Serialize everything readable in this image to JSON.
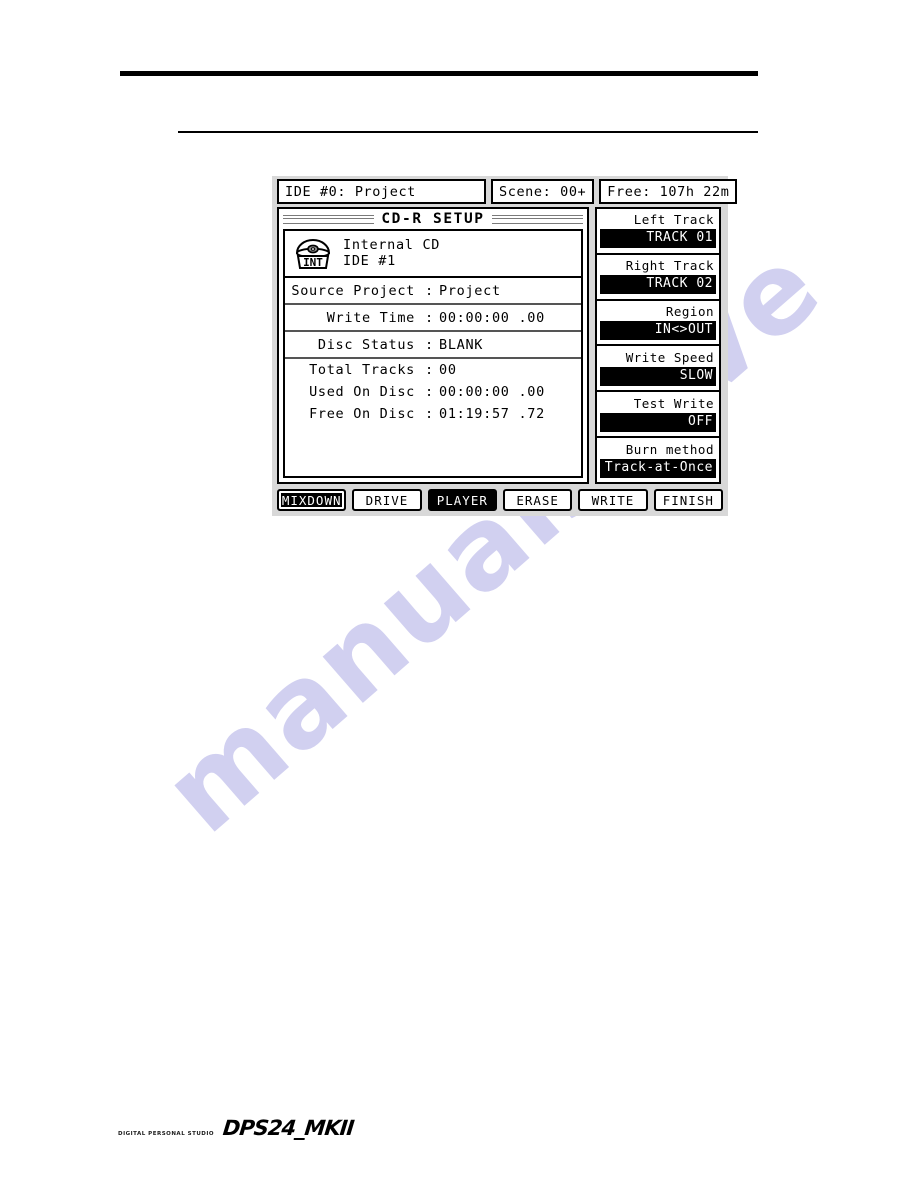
{
  "page": {
    "watermark": "manualshive",
    "footer": {
      "tagline": "DIGITAL PERSONAL STUDIO",
      "model": "DPS24_MKII"
    }
  },
  "device_screen": {
    "topbar": {
      "project": "IDE #0: Project",
      "scene": "Scene: 00+",
      "free_time": "Free: 107h 22m"
    },
    "screen_title": "CD-R SETUP",
    "device": {
      "icon": "cd-disc-icon",
      "icon_label": "INT",
      "name": "Internal CD",
      "bus": "IDE #1"
    },
    "info_rows": [
      {
        "label": "Source Project",
        "colon": ":",
        "value": "Project"
      },
      {
        "label": "Write Time",
        "colon": ":",
        "value": "00:00:00 .00"
      },
      {
        "label": "Disc Status",
        "colon": ":",
        "value": "BLANK"
      },
      {
        "label": "Total Tracks",
        "colon": ":",
        "value": "00"
      },
      {
        "label": "Used On Disc",
        "colon": ":",
        "value": "00:00:00 .00"
      },
      {
        "label": "Free On Disc",
        "colon": ":",
        "value": "01:19:57 .72"
      }
    ],
    "params": [
      {
        "label": "Left Track",
        "value": "TRACK 01"
      },
      {
        "label": "Right Track",
        "value": "TRACK 02"
      },
      {
        "label": "Region",
        "value": "IN<>OUT"
      },
      {
        "label": "Write Speed",
        "value": "SLOW"
      },
      {
        "label": "Test Write",
        "value": "OFF"
      },
      {
        "label": "Burn method",
        "value": "Track-at-Once"
      }
    ],
    "soft_keys": [
      {
        "label": "MIXDOWN",
        "selected": true,
        "focused": true
      },
      {
        "label": "DRIVE",
        "selected": false,
        "focused": false
      },
      {
        "label": "PLAYER",
        "selected": true,
        "focused": false
      },
      {
        "label": "ERASE",
        "selected": false,
        "focused": false
      },
      {
        "label": "WRITE",
        "selected": false,
        "focused": false
      },
      {
        "label": "FINISH",
        "selected": false,
        "focused": false
      }
    ]
  }
}
